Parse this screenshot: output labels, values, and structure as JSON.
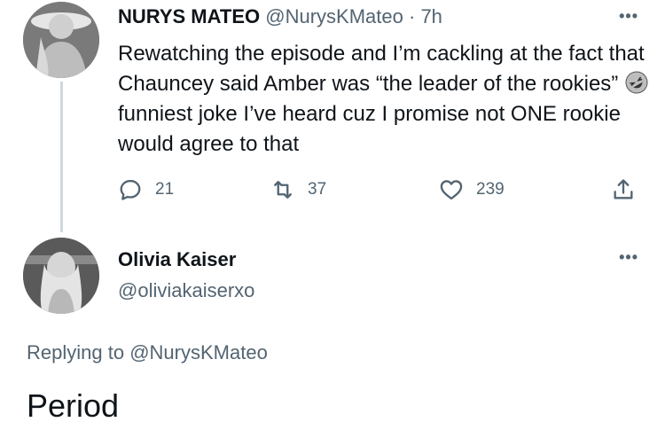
{
  "tweet": {
    "author_name": "NURYS MATEO",
    "author_handle": "@NurysKMateo",
    "separator": "·",
    "time": "7h",
    "more_label": "•••",
    "text_before_emoji": "Rewatching the episode and I’m cackling at the fact that Chauncey said Amber was “the leader of the rookies” ",
    "emoji": "rolling-on-floor-laughing-emoji",
    "text_after_emoji": " funniest joke I’ve heard cuz I promise not ONE rookie would agree to that",
    "stats": {
      "replies": "21",
      "retweets": "37",
      "likes": "239"
    },
    "icons": {
      "reply": "reply-icon",
      "retweet": "retweet-icon",
      "like": "heart-icon",
      "share": "share-icon"
    }
  },
  "reply": {
    "author_name": "Olivia Kaiser",
    "author_handle": "@oliviakaiserxo",
    "more_label": "•••",
    "replying_prefix": "Replying to",
    "replying_to": "@NurysKMateo",
    "text": "Period"
  },
  "colors": {
    "text": "#0f1419",
    "secondary": "#536471",
    "thread_line": "#cfd9de"
  }
}
